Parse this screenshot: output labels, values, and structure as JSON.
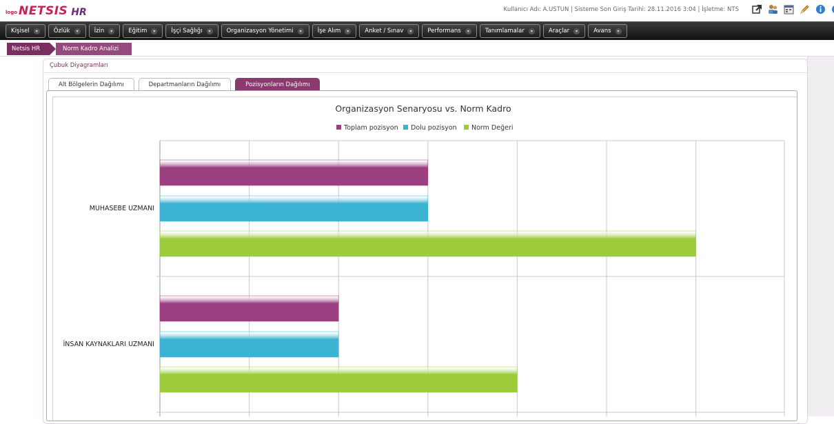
{
  "header": {
    "logo_small": "logo",
    "logo_brand": "NETSIS",
    "logo_product": "HR",
    "user_info": "Kullanıcı Adı: A.USTUN | Sisteme Son Giriş Tarihi: 28.11.2016 3:04 | İşletme: NTS",
    "icons": [
      "external-link-icon",
      "users-icon",
      "calendar-icon",
      "pencil-icon",
      "info-icon",
      "help-icon"
    ]
  },
  "menu": {
    "items": [
      {
        "label": "Kişisel"
      },
      {
        "label": "Özlük"
      },
      {
        "label": "İzin"
      },
      {
        "label": "Eğitim"
      },
      {
        "label": "İşçi Sağlığı"
      },
      {
        "label": "Organizasyon Yönetimi"
      },
      {
        "label": "İşe Alım"
      },
      {
        "label": "Anket / Sınav"
      },
      {
        "label": "Performans"
      },
      {
        "label": "Tanımlamalar"
      },
      {
        "label": "Araçlar"
      },
      {
        "label": "Avans"
      }
    ]
  },
  "breadcrumb": {
    "items": [
      "Netsis HR",
      "Norm Kadro Analizi"
    ]
  },
  "panel": {
    "title": "Çubuk Diyagramları"
  },
  "tabs": [
    {
      "label": "Alt Bölgelerin Dağılımı",
      "active": false
    },
    {
      "label": "Departmanların Dağılımı",
      "active": false
    },
    {
      "label": "Pozisyonların Dağılımı",
      "active": true
    }
  ],
  "chart_data": {
    "type": "bar",
    "orientation": "horizontal",
    "title": "Organizasyon Senaryosu vs. Norm Kadro",
    "legend_position": "top",
    "grid": true,
    "categories": [
      "MUHASEBE UZMANI",
      "İNSAN KAYNAKLARI UZMANI"
    ],
    "xlim": [
      0,
      7
    ],
    "series": [
      {
        "name": "Toplam pozisyon",
        "values": [
          3,
          2
        ],
        "color": "#9c3f80"
      },
      {
        "name": "Dolu pozisyon",
        "values": [
          3,
          2
        ],
        "color": "#3cb3d2"
      },
      {
        "name": "Norm Değeri",
        "values": [
          6,
          4
        ],
        "color": "#9ccc3c"
      }
    ]
  }
}
